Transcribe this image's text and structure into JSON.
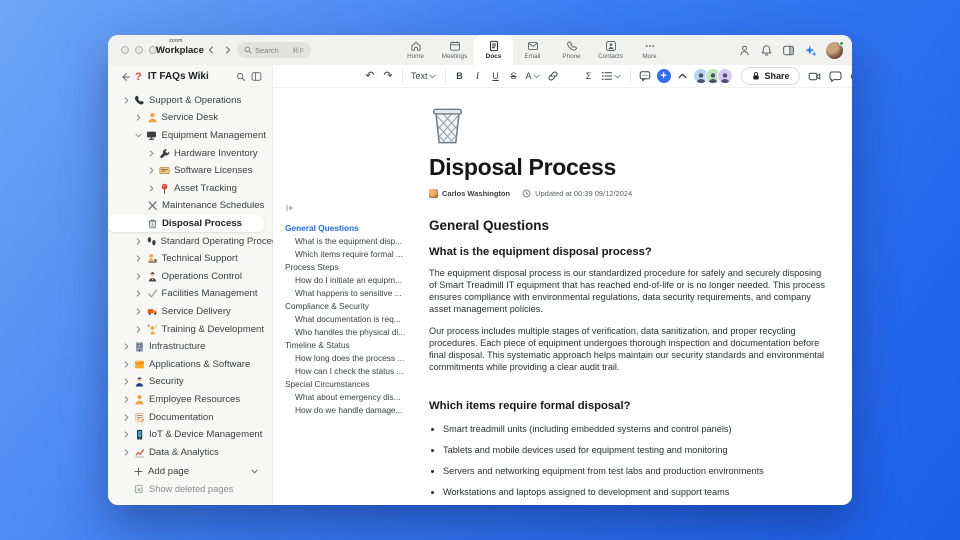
{
  "window": {
    "brand": {
      "top": "zoom",
      "bottom": "Workplace"
    },
    "search": {
      "placeholder": "Search",
      "shortcut": "⌘F"
    },
    "nav": [
      {
        "id": "home",
        "label": "Home"
      },
      {
        "id": "meetings",
        "label": "Meetings"
      },
      {
        "id": "docs",
        "label": "Docs",
        "active": true
      },
      {
        "id": "email",
        "label": "Email"
      },
      {
        "id": "phone",
        "label": "Phone"
      },
      {
        "id": "contacts",
        "label": "Contacts"
      },
      {
        "id": "more",
        "label": "More"
      }
    ],
    "right_icons": [
      "profile",
      "bell",
      "panel",
      "sparkle"
    ]
  },
  "sidebar": {
    "badge": "?",
    "title": "IT FAQs Wiki",
    "items": [
      {
        "label": "Support & Operations",
        "level": 0,
        "chevron": "right",
        "icon": "phone"
      },
      {
        "label": "Service Desk",
        "level": 1,
        "chevron": "right",
        "icon": "service-person"
      },
      {
        "label": "Equipment Management",
        "level": 1,
        "chevron": "down",
        "icon": "monitor"
      },
      {
        "label": "Hardware Inventory",
        "level": 2,
        "chevron": "right",
        "icon": "hardware"
      },
      {
        "label": "Software Licenses",
        "level": 2,
        "chevron": "right",
        "icon": "license"
      },
      {
        "label": "Asset Tracking",
        "level": 2,
        "chevron": "right",
        "icon": "pin"
      },
      {
        "label": "Maintenance Schedules",
        "level": 2,
        "chevron": "none",
        "icon": "tools"
      },
      {
        "label": "Disposal Process",
        "level": 2,
        "chevron": "none",
        "icon": "trash",
        "selected": true
      },
      {
        "label": "Standard Operating Procedures",
        "level": 1,
        "chevron": "right",
        "icon": "footprints"
      },
      {
        "label": "Technical Support",
        "level": 1,
        "chevron": "right",
        "icon": "tech-desk"
      },
      {
        "label": "Operations Control",
        "level": 1,
        "chevron": "right",
        "icon": "officer"
      },
      {
        "label": "Facilities Management",
        "level": 1,
        "chevron": "right",
        "icon": "check"
      },
      {
        "label": "Service Delivery",
        "level": 1,
        "chevron": "right",
        "icon": "truck"
      },
      {
        "label": "Training & Development",
        "level": 1,
        "chevron": "right",
        "icon": "training"
      },
      {
        "label": "Infrastructure",
        "level": 0,
        "chevron": "right",
        "icon": "building"
      },
      {
        "label": "Applications & Software",
        "level": 0,
        "chevron": "right",
        "icon": "apps"
      },
      {
        "label": "Security",
        "level": 0,
        "chevron": "right",
        "icon": "police"
      },
      {
        "label": "Employee Resources",
        "level": 0,
        "chevron": "right",
        "icon": "employee"
      },
      {
        "label": "Documentation",
        "level": 0,
        "chevron": "right",
        "icon": "memo"
      },
      {
        "label": "IoT & Device Management",
        "level": 0,
        "chevron": "right",
        "icon": "device"
      },
      {
        "label": "Data & Analytics",
        "level": 0,
        "chevron": "right",
        "icon": "chart"
      }
    ],
    "add_page": "Add page",
    "show_deleted": "Show deleted pages"
  },
  "toolbar": {
    "style_label": "Text",
    "bold": "B",
    "italic": "I",
    "underline": "U",
    "strikethrough": "S",
    "color": "A",
    "code_label": "</>",
    "equation_label": "Σ",
    "share_label": "Share",
    "collaborators": [
      {
        "color": "#bcd3f7"
      },
      {
        "color": "#bfe3c0"
      },
      {
        "color": "#d9c9f5"
      }
    ]
  },
  "toc": {
    "items": [
      {
        "label": "General Questions",
        "level": 0,
        "active": true
      },
      {
        "label": "What is the equipment disp...",
        "level": 1
      },
      {
        "label": "Which items require formal ...",
        "level": 1
      },
      {
        "label": "Process Steps",
        "level": 0
      },
      {
        "label": "How do I initiate an equipm...",
        "level": 1
      },
      {
        "label": "What happens to sensitive ...",
        "level": 1
      },
      {
        "label": "Compliance & Security",
        "level": 0
      },
      {
        "label": "What documentation is req...",
        "level": 1
      },
      {
        "label": "Who handles the physical di...",
        "level": 1
      },
      {
        "label": "Timeline & Status",
        "level": 0
      },
      {
        "label": "How long does the process ...",
        "level": 1
      },
      {
        "label": "How can I check the status ...",
        "level": 1
      },
      {
        "label": "Special Circumstances",
        "level": 0
      },
      {
        "label": "What about emergency dis...",
        "level": 1
      },
      {
        "label": "How do we handle damage...",
        "level": 1
      }
    ]
  },
  "doc": {
    "title": "Disposal Process",
    "author": "Carlos Washington",
    "updated": "Updated at 00:39 09/12/2024",
    "blocks": [
      {
        "type": "h2",
        "text": "General Questions"
      },
      {
        "type": "h3",
        "text": "What is the equipment disposal process?"
      },
      {
        "type": "p",
        "text": "The equipment disposal process is our standardized procedure for safely and securely disposing of Smart Treadmill IT equipment that has reached end-of-life or is no longer needed. This process ensures compliance with environmental regulations, data security requirements, and company asset management policies."
      },
      {
        "type": "p",
        "text": "Our process includes multiple stages of verification, data sanitization, and proper recycling procedures. Each piece of equipment undergoes thorough inspection and documentation before final disposal. This systematic approach helps maintain our security standards and environmental commitments while providing a clear audit trail."
      },
      {
        "type": "h3",
        "text": "Which items require formal disposal?",
        "gap": true
      },
      {
        "type": "ul",
        "items": [
          "Smart treadmill units (including embedded systems and control panels)",
          "Tablets and mobile devices used for equipment testing and monitoring",
          "Servers and networking equipment from test labs and production environments",
          "Workstations and laptops assigned to development and support teams"
        ]
      }
    ]
  },
  "colors": {
    "accent": "#2e6ff2",
    "active_link": "#1a6ef5",
    "badge_red": "#e03e2f"
  }
}
